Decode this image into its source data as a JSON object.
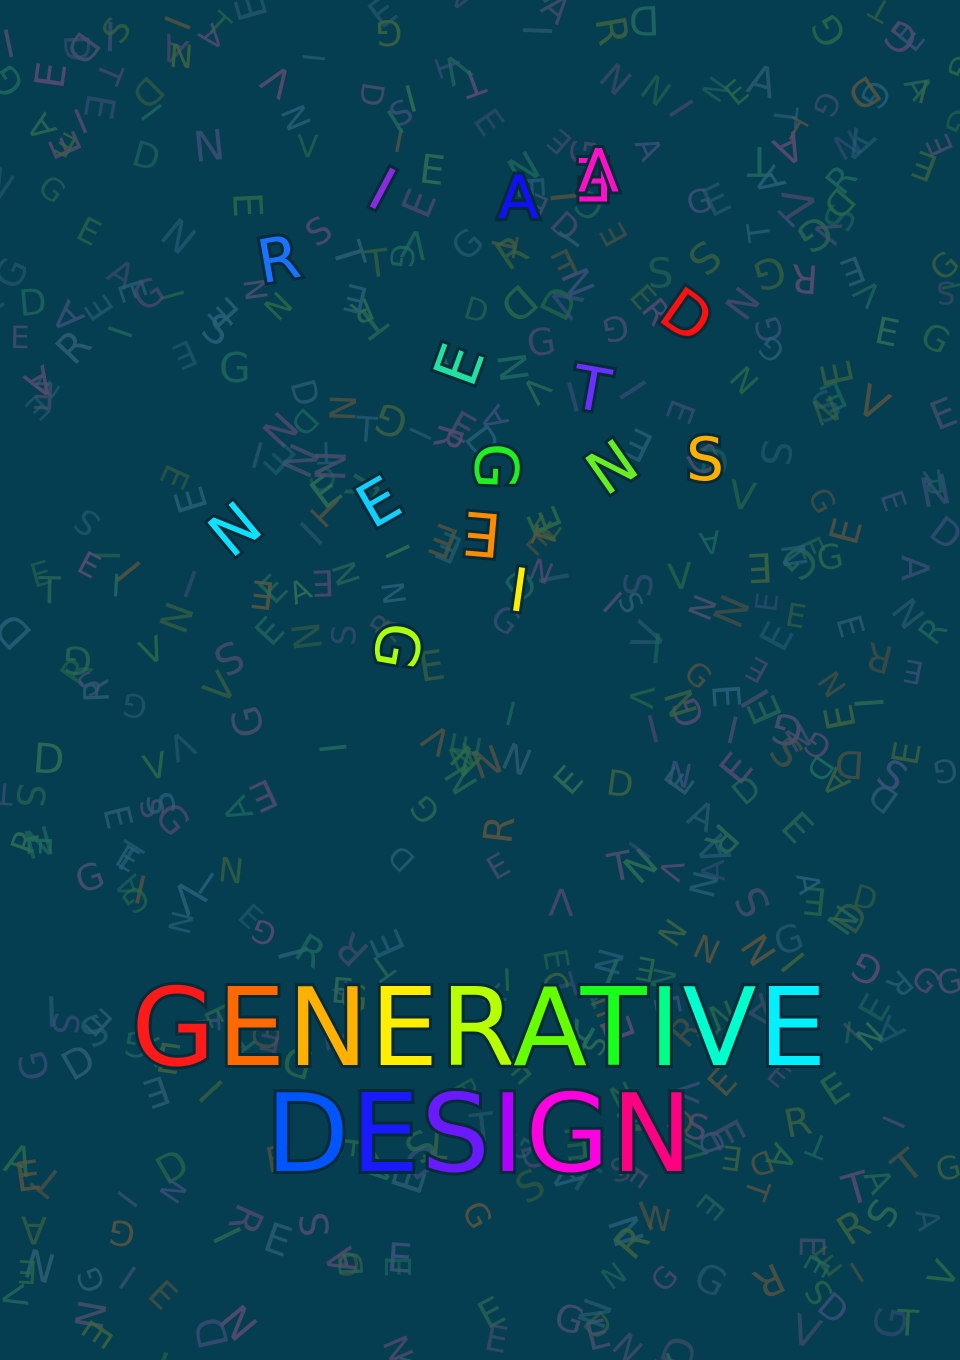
{
  "poster": {
    "background_color": "#053e50",
    "background_letter_pool": "GENERATIVEDESIGN",
    "cluster_letters": [
      {
        "char": "R",
        "color": "#1a73ff"
      },
      {
        "char": "I",
        "color": "#8a2be2"
      },
      {
        "char": "A",
        "color": "#1010ff"
      },
      {
        "char": "E",
        "color": "#ff10c8"
      },
      {
        "char": "V",
        "color": "#ff10c8"
      },
      {
        "char": "D",
        "color": "#ff1010"
      },
      {
        "char": "E",
        "color": "#22e0a0"
      },
      {
        "char": "T",
        "color": "#6a30ff"
      },
      {
        "char": "S",
        "color": "#ffb000"
      },
      {
        "char": "G",
        "color": "#22ee22"
      },
      {
        "char": "N",
        "color": "#66ee22"
      },
      {
        "char": "E",
        "color": "#ff8c00"
      },
      {
        "char": "I",
        "color": "#ffee00"
      },
      {
        "char": "E",
        "color": "#10d0ff"
      },
      {
        "char": "N",
        "color": "#10e0ff"
      },
      {
        "char": "G",
        "color": "#aaff10"
      }
    ],
    "title_line1": "GENERATIVE",
    "title_line2": "DESIGN",
    "title_line1_colors": [
      "#ff1a1a",
      "#ff6a00",
      "#ffb000",
      "#ffee00",
      "#b8ff00",
      "#66ff00",
      "#1aff1a",
      "#00ff88",
      "#00ffcc",
      "#00f0ff"
    ],
    "title_line2_colors": [
      "#0055ff",
      "#1a1aff",
      "#6a1aff",
      "#b000ff",
      "#ff00e0",
      "#ff0080"
    ]
  }
}
